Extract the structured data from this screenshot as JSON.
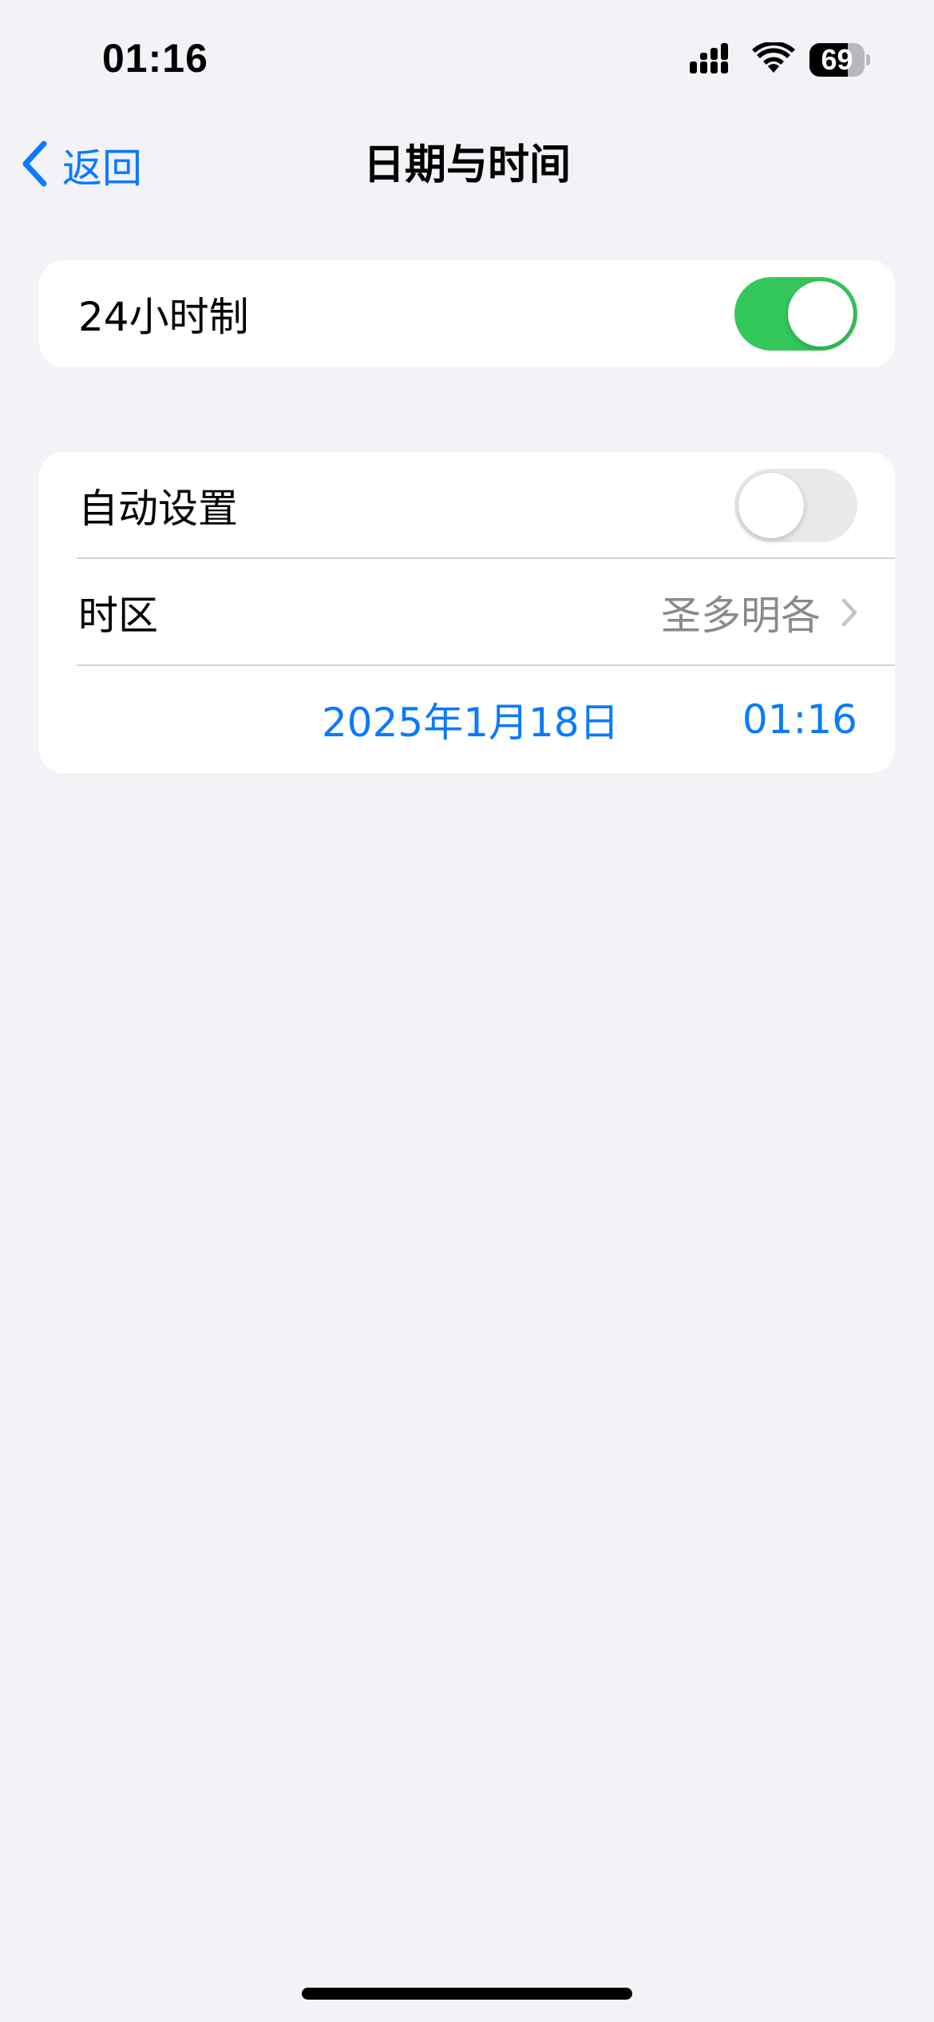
{
  "status_bar": {
    "time": "01:16",
    "battery_level": "69",
    "battery_fraction": 0.69,
    "icons": [
      "cellular-signal-icon",
      "wifi-icon",
      "battery-icon"
    ]
  },
  "nav": {
    "back_label": "返回",
    "title": "日期与时间"
  },
  "settings": {
    "hour24": {
      "label": "24小时制",
      "enabled": true
    },
    "auto_set": {
      "label": "自动设置",
      "enabled": false
    },
    "time_zone": {
      "label": "时区",
      "value": "圣多明各"
    },
    "datetime": {
      "date": "2025年1月18日",
      "time": "01:16"
    }
  },
  "colors": {
    "accent": "#0a7aff",
    "toggle_on": "#34c759",
    "toggle_off": "#e9e9eb",
    "background": "#f2f2f7",
    "secondary_text": "#8a8a8e"
  }
}
